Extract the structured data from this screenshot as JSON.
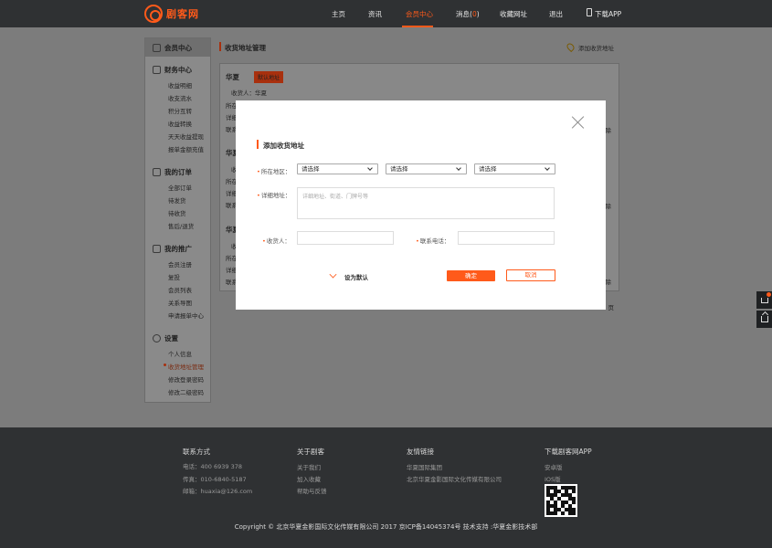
{
  "header": {
    "logo_text": "剧客网",
    "nav": [
      {
        "label": "主页"
      },
      {
        "label": "资讯"
      },
      {
        "label": "会员中心",
        "active": true
      },
      {
        "label": "消息",
        "count": "0"
      },
      {
        "label": "收藏网址"
      },
      {
        "label": "退出"
      },
      {
        "label": "下载APP"
      }
    ]
  },
  "sidebar": {
    "sections": [
      {
        "title": "会员中心",
        "items": []
      },
      {
        "title": "财务中心",
        "items": [
          "收益明细",
          "收支流水",
          "积分互转",
          "收益转换",
          "天天收益提现",
          "报单金额充值"
        ]
      },
      {
        "title": "我的订单",
        "items": [
          "全部订单",
          "待发货",
          "待收货",
          "售后/退货"
        ]
      },
      {
        "title": "我的推广",
        "items": [
          "会员注册",
          "复投",
          "会员列表",
          "关系导图",
          "申请报单中心"
        ]
      },
      {
        "title": "设置",
        "items": [
          "个人信息",
          "收货地址管理",
          "修改登录密码",
          "修改二级密码"
        ]
      }
    ],
    "current_item": "收货地址管理"
  },
  "main": {
    "title": "收货地址管理",
    "add_address": "添加收货地址",
    "addresses": [
      {
        "name": "华夏",
        "default_tag": "默认地址",
        "receiver": "收货人：华夏",
        "line2": "所在",
        "line3": "详细",
        "line4": "联系",
        "side": "除"
      },
      {
        "name": "华夏",
        "line1": "收",
        "line2": "所在",
        "line3": "详细",
        "line4": "联系",
        "side": "除"
      },
      {
        "name": "华夏",
        "line1": "收",
        "line2": "所在",
        "line3": "详细",
        "line4": "联系",
        "side": "除"
      }
    ],
    "page_hint": "页"
  },
  "modal": {
    "title": "添加收货地址",
    "region_label": "所在地区：",
    "selects": [
      "请选择",
      "请选择",
      "请选择"
    ],
    "detail_label": "详细地址：",
    "detail_placeholder": "详细地址、街道、门牌号等",
    "receiver_label": "收货人：",
    "phone_label": "联系电话：",
    "default_label": "设为默认",
    "ok": "确定",
    "cancel": "取消"
  },
  "footer": {
    "contact": {
      "title": "联系方式",
      "items": [
        "电话：400 6939 378",
        "传真：010-6840-5187",
        "邮箱：huaxia@126.com"
      ]
    },
    "about": {
      "title": "关于剧客",
      "items": [
        "关于我们",
        "加入收藏",
        "帮助与反馈"
      ]
    },
    "links": {
      "title": "友情链接",
      "items": [
        "华夏国际集团",
        "北京华夏金影国际文化传媒有限公司"
      ]
    },
    "download": {
      "title": "下载剧客网APP",
      "items": [
        "安卓版",
        "IOS版"
      ]
    },
    "copyright": "Copyright © 北京华夏金影国际文化传媒有限公司    2017 京ICP备14045374号    技术支持 :华夏金影技术部"
  },
  "colors": {
    "accent": "#ff5a1a",
    "header_bg": "#2f3133",
    "overlay": "#7a7a7a"
  }
}
